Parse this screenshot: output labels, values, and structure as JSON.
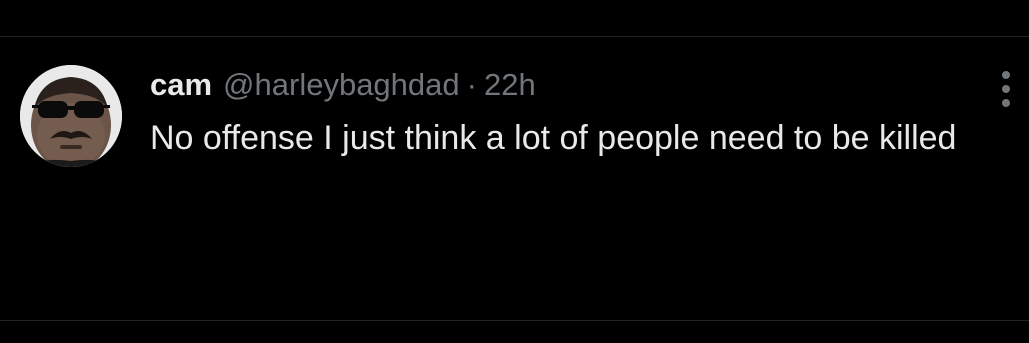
{
  "tweet": {
    "name": "cam",
    "handle": "@harleybaghdad",
    "separator": "·",
    "time": "22h",
    "text": "No offense I just think a lot of people need to be killed"
  },
  "icons": {
    "more": "more-vertical-icon",
    "avatar": "user-avatar"
  },
  "colors": {
    "background": "#000000",
    "primary_text": "#e7e9ea",
    "secondary_text": "#71767b",
    "divider": "#1f2225"
  }
}
